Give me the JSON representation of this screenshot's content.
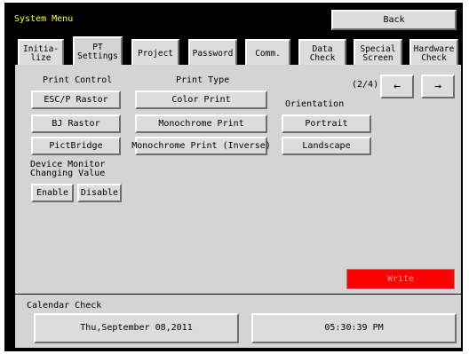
{
  "window": {
    "title": "System Menu",
    "back_label": "Back"
  },
  "tabs": [
    {
      "label": "Initia-\nlize"
    },
    {
      "label": "PT\nSettings"
    },
    {
      "label": "Project"
    },
    {
      "label": "Password"
    },
    {
      "label": "Comm."
    },
    {
      "label": "Data\nCheck"
    },
    {
      "label": "Special\nScreen"
    },
    {
      "label": "Hardware\nCheck"
    }
  ],
  "print_control": {
    "heading": "Print Control",
    "buttons": [
      "ESC/P Rastor",
      "BJ Rastor",
      "PictBridge"
    ]
  },
  "print_type": {
    "heading": "Print Type",
    "buttons": [
      "Color Print",
      "Monochrome Print",
      "Monochrome Print (Inverse)"
    ]
  },
  "orientation": {
    "heading": "Orientation",
    "buttons": [
      "Portrait",
      "Landscape"
    ]
  },
  "pager": {
    "text": "(2/4)",
    "prev": "←",
    "next": "→"
  },
  "device_monitor": {
    "heading": "Device Monitor\nChanging Value",
    "enable": "Enable",
    "disable": "Disable"
  },
  "write_label": "Write",
  "calendar": {
    "heading": "Calendar Check",
    "date": "Thu,September 08,2011",
    "time": "05:30:39 PM"
  },
  "colors": {
    "title_text": "#ffff00",
    "write_button": "#ff0000",
    "frame": "#000000",
    "panel": "#d4d4d4"
  }
}
